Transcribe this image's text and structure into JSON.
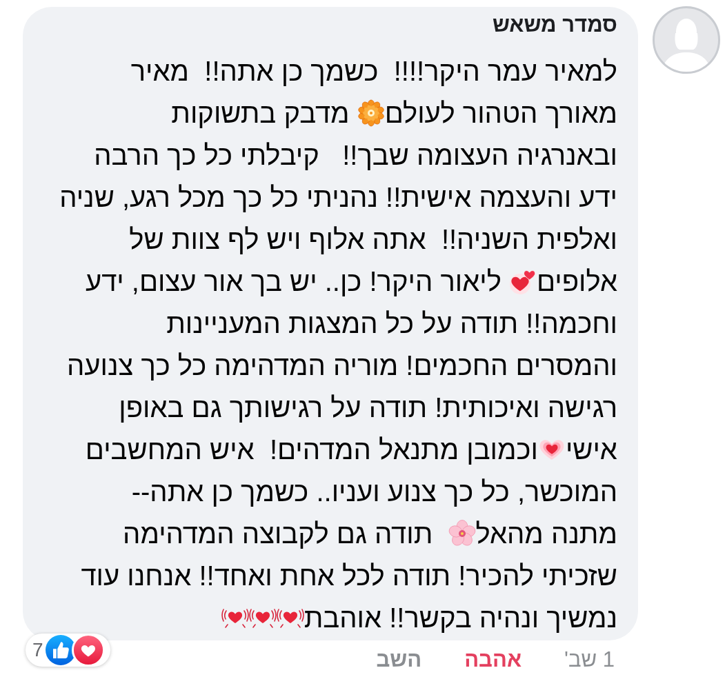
{
  "comment": {
    "author": "סמדר משאש",
    "lines": [
      [
        {
          "kind": "text",
          "text": "למאיר עמר היקר!!!!  כשמך כן אתה!!  מאיר"
        }
      ],
      [
        {
          "kind": "text",
          "text": "מאורך הטהור לעולם"
        },
        {
          "kind": "rosette"
        },
        {
          "kind": "text",
          "text": " מדבק בתשוקות"
        }
      ],
      [
        {
          "kind": "text",
          "text": "ובאנרגיה העצומה שבך!!   קיבלתי כל כך הרבה"
        }
      ],
      [
        {
          "kind": "text",
          "text": "ידע והעצמה אישית!! נהניתי כל כך מכל רגע, שניה"
        }
      ],
      [
        {
          "kind": "text",
          "text": "ואלפית השניה!!  אתה אלוף ויש לף צוות של"
        }
      ],
      [
        {
          "kind": "text",
          "text": "אלופים"
        },
        {
          "kind": "hearts"
        },
        {
          "kind": "text",
          "text": " ליאור היקר! כן.. יש בך אור עצום, ידע"
        }
      ],
      [
        {
          "kind": "text",
          "text": "וחכמה!! תודה על כל המצגות המעניינות"
        }
      ],
      [
        {
          "kind": "text",
          "text": "והמסרים החכמים! מוריה המדהימה כל כך צנועה"
        }
      ],
      [
        {
          "kind": "text",
          "text": "רגישה ואיכותית! תודה על רגישותך גם באופן"
        }
      ],
      [
        {
          "kind": "text",
          "text": "אישי"
        },
        {
          "kind": "glowing"
        },
        {
          "kind": "text",
          "text": "וכמובן מתנאל המדהים!  איש המחשבים"
        }
      ],
      [
        {
          "kind": "text",
          "text": "המוכשר, כל כך צנוע ועניו.. כשמך כן אתה--"
        }
      ],
      [
        {
          "kind": "text",
          "text": "מתנה מהאל"
        },
        {
          "kind": "blossom"
        },
        {
          "kind": "text",
          "text": "  תודה גם לקבוצה המדהימה"
        }
      ],
      [
        {
          "kind": "text",
          "text": "שזכיתי להכיר! תודה לכל אחת ואחד!! אנחנו עוד"
        }
      ],
      [
        {
          "kind": "text",
          "text": "נמשיך ונהיה בקשר!! אוהבת"
        },
        {
          "kind": "beating"
        },
        {
          "kind": "beating"
        },
        {
          "kind": "beating"
        }
      ]
    ],
    "reaction_count": "7"
  },
  "actions": {
    "timestamp": "1 שב'",
    "reaction_button": {
      "label": "אהבה",
      "selected": true
    },
    "reply_button": {
      "label": "השב"
    }
  }
}
